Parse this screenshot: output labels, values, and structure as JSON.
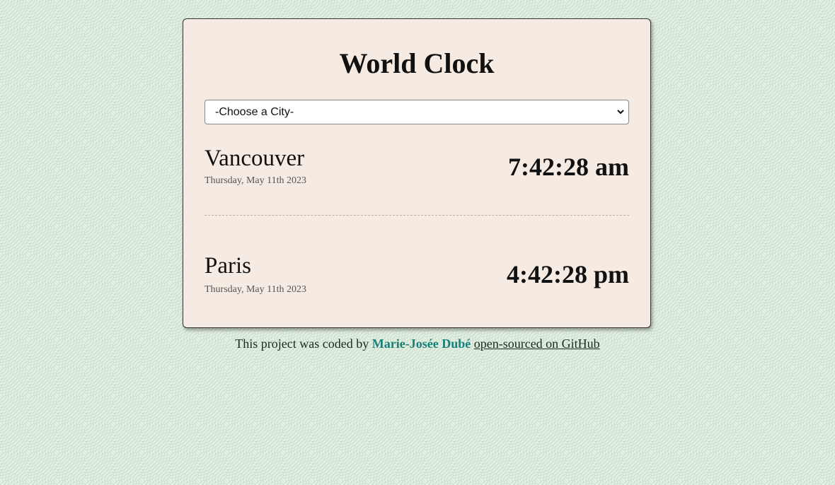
{
  "app": {
    "title": "World Clock"
  },
  "city_select": {
    "selected": "-Choose a City-",
    "chevron_icon": "chevron-down-icon"
  },
  "cities": [
    {
      "name": "Vancouver",
      "date": "Thursday, May 11th 2023",
      "time": "7:42:28 am"
    },
    {
      "name": "Paris",
      "date": "Thursday, May 11th 2023",
      "time": "4:42:28 pm"
    }
  ],
  "footer": {
    "prefix": "This project was coded by ",
    "author": "Marie-Josée Dubé",
    "link_text": "open-sourced on GitHub"
  },
  "colors": {
    "page_background": "#e3efe3",
    "card_background": "#f5ebe2",
    "author_accent": "#1a7f78"
  }
}
